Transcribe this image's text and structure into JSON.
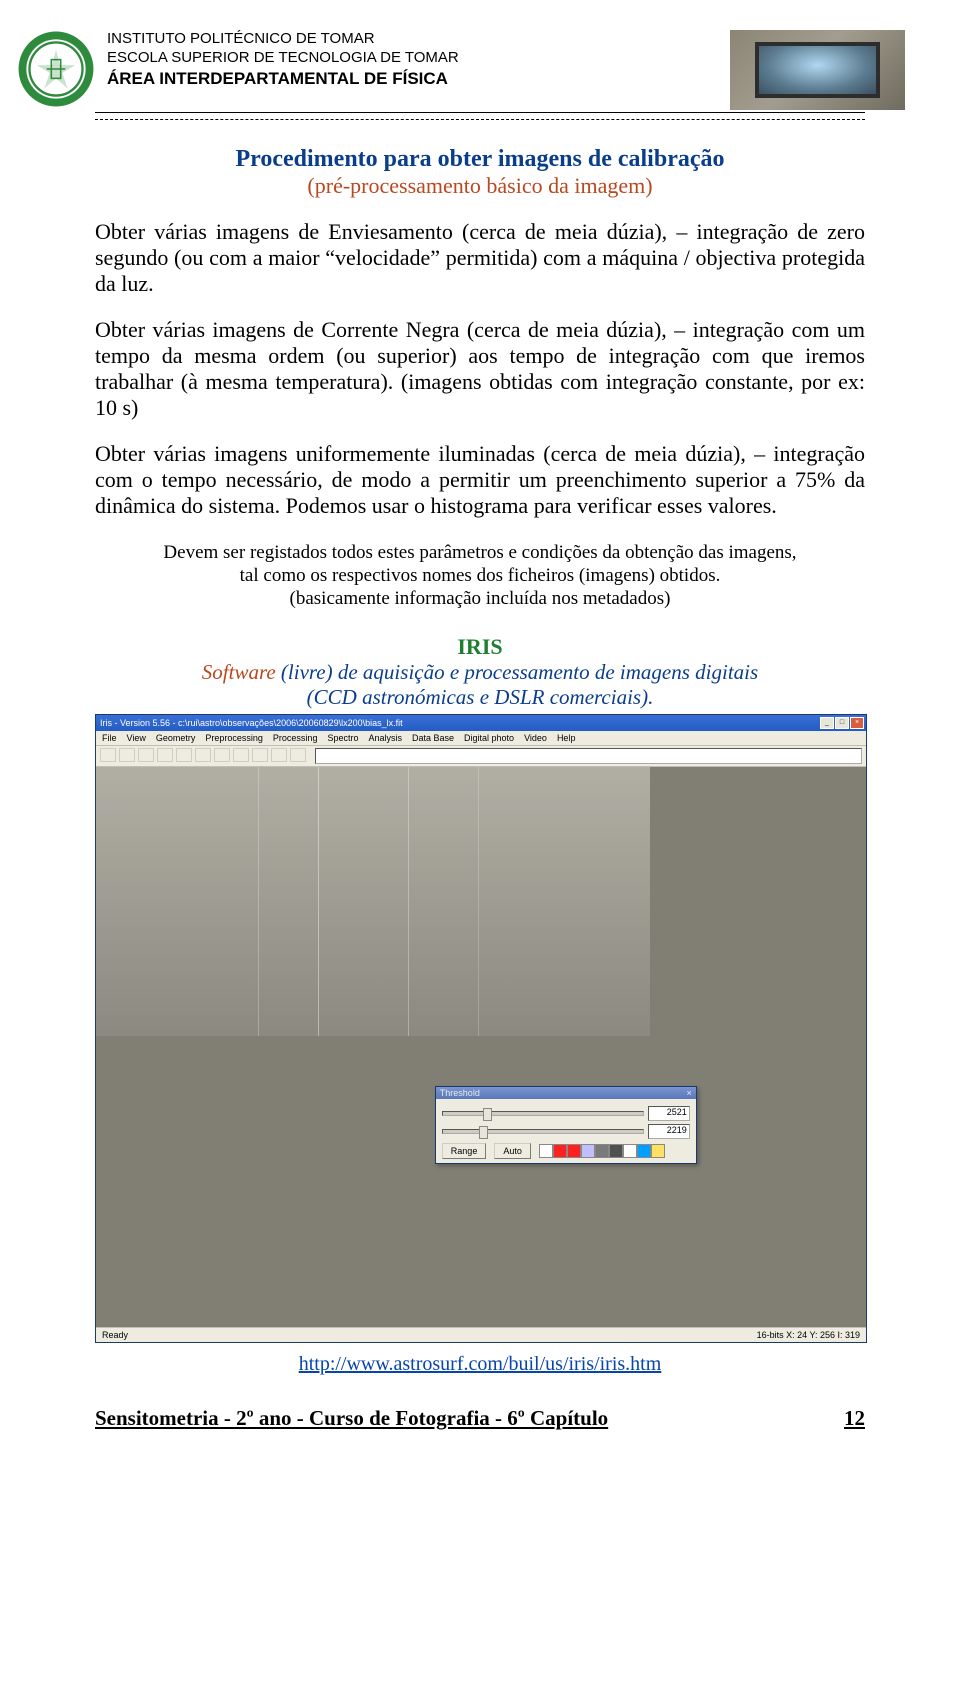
{
  "header": {
    "line1": "INSTITUTO POLITÉCNICO DE TOMAR",
    "line2": "ESCOLA SUPERIOR DE TECNOLOGIA DE TOMAR",
    "line3": "ÁREA INTERDEPARTAMENTAL DE FÍSICA"
  },
  "title": "Procedimento para obter imagens de calibração",
  "subtitle": "(pré-processamento básico da imagem)",
  "para1": "Obter várias imagens de Enviesamento (cerca de meia dúzia),  – integração de zero segundo (ou com a maior “velocidade” permitida) com a máquina / objectiva protegida da luz.",
  "para2": "Obter várias imagens de Corrente Negra (cerca de meia dúzia),  – integração com um tempo da mesma ordem (ou superior) aos tempo de integração com que iremos trabalhar (à mesma temperatura).  (imagens obtidas com integração constante, por ex: 10 s)",
  "para3": "Obter várias imagens uniformemente iluminadas (cerca de meia dúzia),  – integração com o tempo necessário, de modo a permitir um preenchimento superior a 75% da dinâmica do sistema. Podemos usar o histograma para verificar esses valores.",
  "note_line1": "Devem ser registados todos estes parâmetros e condições da obtenção das imagens,",
  "note_line2": "tal como os respectivos nomes dos ficheiros (imagens) obtidos.",
  "note_line3": "(basicamente informação incluída nos metadados)",
  "iris": {
    "name": "IRIS",
    "software_word": "Software",
    "sub1_rest": " (livre) de aquisição e processamento de imagens digitais",
    "sub2": "(CCD astronómicas e DSLR comerciais)."
  },
  "app": {
    "title": "Iris - Version 5.56 - c:\\rui\\astro\\observações\\2006\\20060829\\lx200\\bias_lx.fit",
    "menus": [
      "File",
      "View",
      "Geometry",
      "Preprocessing",
      "Processing",
      "Spectro",
      "Analysis",
      "Data Base",
      "Digital photo",
      "Video",
      "Help"
    ],
    "threshold": {
      "title": "Threshold",
      "high": "2521",
      "low": "2219",
      "btn_range": "Range",
      "btn_auto": "Auto",
      "swatches": [
        "#fff",
        "#ff2020",
        "#ff2020",
        "#c0c0ff",
        "#7a7a7a",
        "#505050",
        "#fff",
        "#00a0ff",
        "#ffe060"
      ]
    },
    "status_left": "Ready",
    "status_right": "16-bits    X: 24    Y: 256    I: 319"
  },
  "url_text": "http://www.astrosurf.com/buil/us/iris/iris.htm",
  "footer": {
    "left": "Sensitometria  -  2º ano  -  Curso de Fotografia  -  6º Capítulo",
    "page": "12"
  }
}
